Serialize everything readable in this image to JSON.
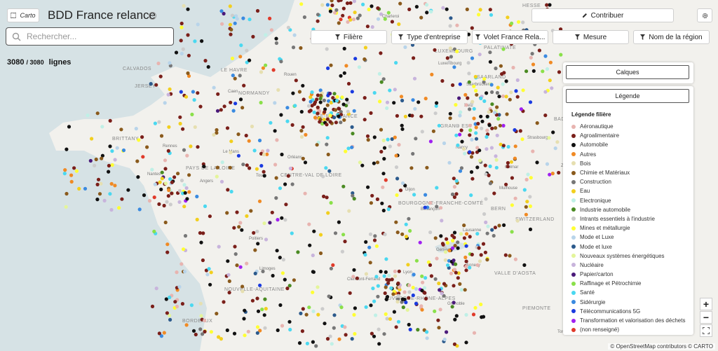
{
  "header": {
    "carto_label": "Carto",
    "title": "BDD France relance",
    "contribute_label": "Contribuer",
    "search_placeholder": "Rechercher..."
  },
  "count": {
    "shown": "3080",
    "total": "/ 3080",
    "unit": "lignes"
  },
  "filters": [
    {
      "label": "Filière"
    },
    {
      "label": "Type d'entreprise"
    },
    {
      "label": "Volet France Rela..."
    },
    {
      "label": "Mesure"
    },
    {
      "label": "Nom de la région"
    }
  ],
  "panels": {
    "layers_label": "Calques",
    "legend_label": "Légende"
  },
  "legend": {
    "title": "Légende filière",
    "items": [
      {
        "label": "Aéronautique",
        "color": "#e8b4b0"
      },
      {
        "label": "Agroalimentaire",
        "color": "#7a1f1a"
      },
      {
        "label": "Automobile",
        "color": "#111111"
      },
      {
        "label": "Autres",
        "color": "#f08a24"
      },
      {
        "label": "Bois",
        "color": "#e6dfb0"
      },
      {
        "label": "Chimie et Matériaux",
        "color": "#8a5a1c"
      },
      {
        "label": "Construction",
        "color": "#777777"
      },
      {
        "label": "Eau",
        "color": "#f2cf1e"
      },
      {
        "label": "Electronique",
        "color": "#bff0e6"
      },
      {
        "label": "Industrie automobile",
        "color": "#4a8a22"
      },
      {
        "label": "Intrants essentiels à l'industrie",
        "color": "#cccccc"
      },
      {
        "label": "Mines et métallurgie",
        "color": "#ffff33"
      },
      {
        "label": "Mode et Luxe",
        "color": "#b8d4ea"
      },
      {
        "label": "Mode et luxe",
        "color": "#2c5a8c"
      },
      {
        "label": "Nouveaux systèmes énergétiques",
        "color": "#e4f59a"
      },
      {
        "label": "Nucléaire",
        "color": "#c8b4dc"
      },
      {
        "label": "Papier/carton",
        "color": "#4a1a7a"
      },
      {
        "label": "Raffinage et Pétrochimie",
        "color": "#8ae04a"
      },
      {
        "label": "Santé",
        "color": "#4ad8f0"
      },
      {
        "label": "Sidérurgie",
        "color": "#3a8ae0"
      },
      {
        "label": "Télécommunications 5G",
        "color": "#1a3ae0"
      },
      {
        "label": "Transformation et valorisation des déchets",
        "color": "#a020f0"
      },
      {
        "label": "(non renseigné)",
        "color": "#e03a2a"
      }
    ]
  },
  "map_labels": [
    "HESSE",
    "LUXEMBOURG",
    "PALATINATE",
    "Luxembourg",
    "SAARLAND",
    "Saarbrücken",
    "CALVADOS",
    "JERSEY",
    "NORMANDY",
    "LE HAVRE",
    "Caen",
    "Rouen",
    "BRITTANY",
    "Rennes",
    "Le Mans",
    "PAYS DE LA LOIRE",
    "Nantes",
    "Angers",
    "Tours",
    "CENTRE-VAL DE LOIRE",
    "Orléans",
    "ÎLE-DE-FRANCE",
    "GRAND EST",
    "Metz",
    "Nancy",
    "Strasbourg",
    "Colmar",
    "Mulhouse",
    "Dijon",
    "BOURGOGNE-FRANCHE-COMTÉ",
    "Besançon",
    "BERN",
    "SWITZERLAND",
    "BADEN-WÜRTTEMBERG",
    "Zürich",
    "Genève",
    "Lausanne",
    "Annecy",
    "Lyon",
    "AUVERGNE-RHÔNE-ALPES",
    "Grenoble",
    "Clermont-Ferrand",
    "Limoges",
    "Poitiers",
    "NOUVELLE-AQUITAINE",
    "BORDEAUX",
    "VALLE D'AOSTA",
    "PIEMONTE",
    "Torino",
    "Charleroi"
  ],
  "attribution": "© OpenStreetMap contributors © CARTO"
}
